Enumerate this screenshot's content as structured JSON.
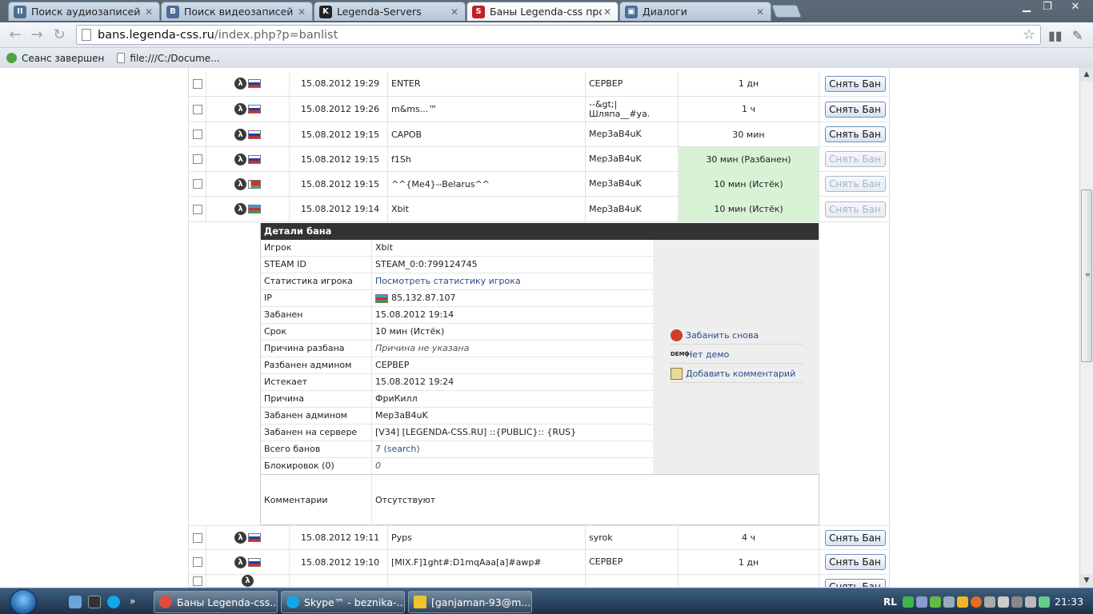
{
  "browser": {
    "tabs": [
      {
        "label": "Поиск аудиозаписей по",
        "icon_color": "#4b6e96",
        "icon_text": "II"
      },
      {
        "label": "Поиск видеозаписей по",
        "icon_color": "#4b6e96",
        "icon_text": "B"
      },
      {
        "label": "Legenda-Servers",
        "icon_color": "#222222",
        "icon_text": "K"
      },
      {
        "label": "Баны Legenda-css прое",
        "icon_color": "#c21f1f",
        "icon_text": "S"
      },
      {
        "label": "Диалоги",
        "icon_color": "#4b6e96",
        "icon_text": "▣"
      }
    ],
    "address": {
      "host": "bans.legenda-css.ru",
      "path": "/index.php?p=banlist"
    },
    "bookmarks": [
      {
        "label": "Сеанс завершен"
      },
      {
        "label": "file:///C:/Docume..."
      }
    ]
  },
  "banlist": {
    "unban_label": "Снять Бан",
    "rows_top": [
      {
        "date": "15.08.2012 19:29",
        "nick": "ENTER",
        "admin": "СЕРВЕР",
        "length": "1 дн",
        "flag": "ru",
        "expired": false
      },
      {
        "date": "15.08.2012 19:26",
        "nick": "m&ms...™",
        "admin": "--&gt;| Шляпа__#ya.",
        "length": "1 ч",
        "flag": "ru",
        "expired": false
      },
      {
        "date": "15.08.2012 19:15",
        "nick": "CAPOB",
        "admin": "Mep3aB4uK",
        "length": "30 мин",
        "flag": "ru",
        "expired": false
      },
      {
        "date": "15.08.2012 19:15",
        "nick": "f1Sh",
        "admin": "Mep3aB4uK",
        "length": "30 мин (Разбанен)",
        "flag": "ru",
        "expired": true
      },
      {
        "date": "15.08.2012 19:15",
        "nick": "^^{Me4}--Belarus^^",
        "admin": "Mep3aB4uK",
        "length": "10 мин (Истёк)",
        "flag": "by",
        "expired": true
      },
      {
        "date": "15.08.2012 19:14",
        "nick": "Xbit",
        "admin": "Mep3aB4uK",
        "length": "10 мин (Истёк)",
        "flag": "az",
        "expired": true
      }
    ],
    "rows_bottom": [
      {
        "date": "15.08.2012 19:11",
        "nick": "Pyps",
        "admin": "syrok",
        "length": "4 ч",
        "flag": "ru",
        "expired": false
      },
      {
        "date": "15.08.2012 19:10",
        "nick": "[MIX.F]1ght#:D1mqAaa[a]#awp#",
        "admin": "СЕРВЕР",
        "length": "1 дн",
        "flag": "ru",
        "expired": false
      }
    ]
  },
  "details": {
    "title": "Детали бана",
    "rows": [
      {
        "key": "Игрок",
        "value": "Xbit"
      },
      {
        "key": "STEAM ID",
        "value": "STEAM_0:0:799124745"
      },
      {
        "key": "Статистика игрока",
        "value": "Посмотреть статистику игрока"
      },
      {
        "key": "IP",
        "value": "85.132.87.107"
      },
      {
        "key": "Забанен",
        "value": "15.08.2012 19:14"
      },
      {
        "key": "Срок",
        "value": "10 мин (Истёк)"
      },
      {
        "key": "Причина разбана",
        "value": "Причина не указана"
      },
      {
        "key": "Разбанен админом",
        "value": "СЕРВЕР"
      },
      {
        "key": "Истекает",
        "value": "15.08.2012 19:24"
      },
      {
        "key": "Причина",
        "value": "ФриКилл"
      },
      {
        "key": "Забанен админом",
        "value": "Mep3aB4uK"
      },
      {
        "key": "Забанен на сервере",
        "value": "[V34] [LEGENDA-CSS.RU] ::{PUBLIC}:: {RUS}"
      },
      {
        "key": "Всего банов",
        "value": "7 (search)"
      },
      {
        "key": "Блокировок (0)",
        "value": "0"
      }
    ],
    "comments_key": "Комментарии",
    "comments_value": "Отсутствуют",
    "actions": [
      {
        "label": "Забанить снова",
        "icon": "stop-icon"
      },
      {
        "label": "Нет демо",
        "icon": "demo-icon"
      },
      {
        "label": "Добавить комментарий",
        "icon": "notepad-icon"
      }
    ]
  },
  "taskbar": {
    "windows": [
      {
        "label": "Баны Legenda-css....",
        "icon_color": "#e24b3b"
      },
      {
        "label": "Skype™ - beznika-...",
        "icon_color": "#12a5e8"
      },
      {
        "label": "[ganjaman-93@m....",
        "icon_color": "#e9c62b"
      }
    ],
    "language": "RL",
    "clock": "21:33"
  }
}
